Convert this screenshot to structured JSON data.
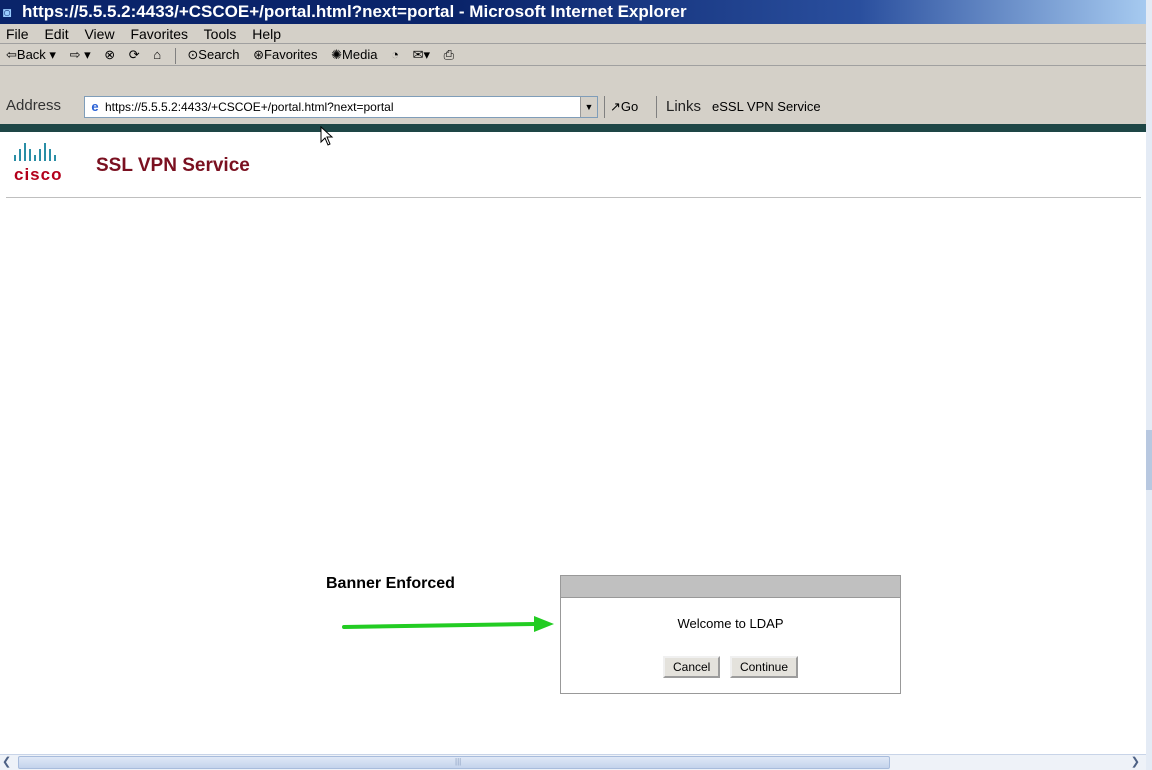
{
  "window": {
    "title": "https://5.5.5.2:4433/+CSCOE+/portal.html?next=portal - Microsoft Internet Explorer"
  },
  "menu": {
    "items": [
      "File",
      "Edit",
      "View",
      "Favorites",
      "Tools",
      "Help"
    ]
  },
  "toolbar": {
    "back": "⇦Back ▾",
    "forward": "⇨ ▾",
    "search": "Search",
    "favorites": "Favorites",
    "media": "Media"
  },
  "address": {
    "label": "Address",
    "url": "https://5.5.5.2:4433/+CSCOE+/portal.html?next=portal",
    "go": "Go",
    "links_label": "Links",
    "links_item": "SSL VPN Service"
  },
  "page": {
    "logo_text": "cisco",
    "title": "SSL VPN Service"
  },
  "annotation": {
    "label": "Banner Enforced",
    "arrow_color": "#22cc22"
  },
  "dialog": {
    "message": "Welcome to LDAP",
    "cancel": "Cancel",
    "continue": "Continue"
  }
}
